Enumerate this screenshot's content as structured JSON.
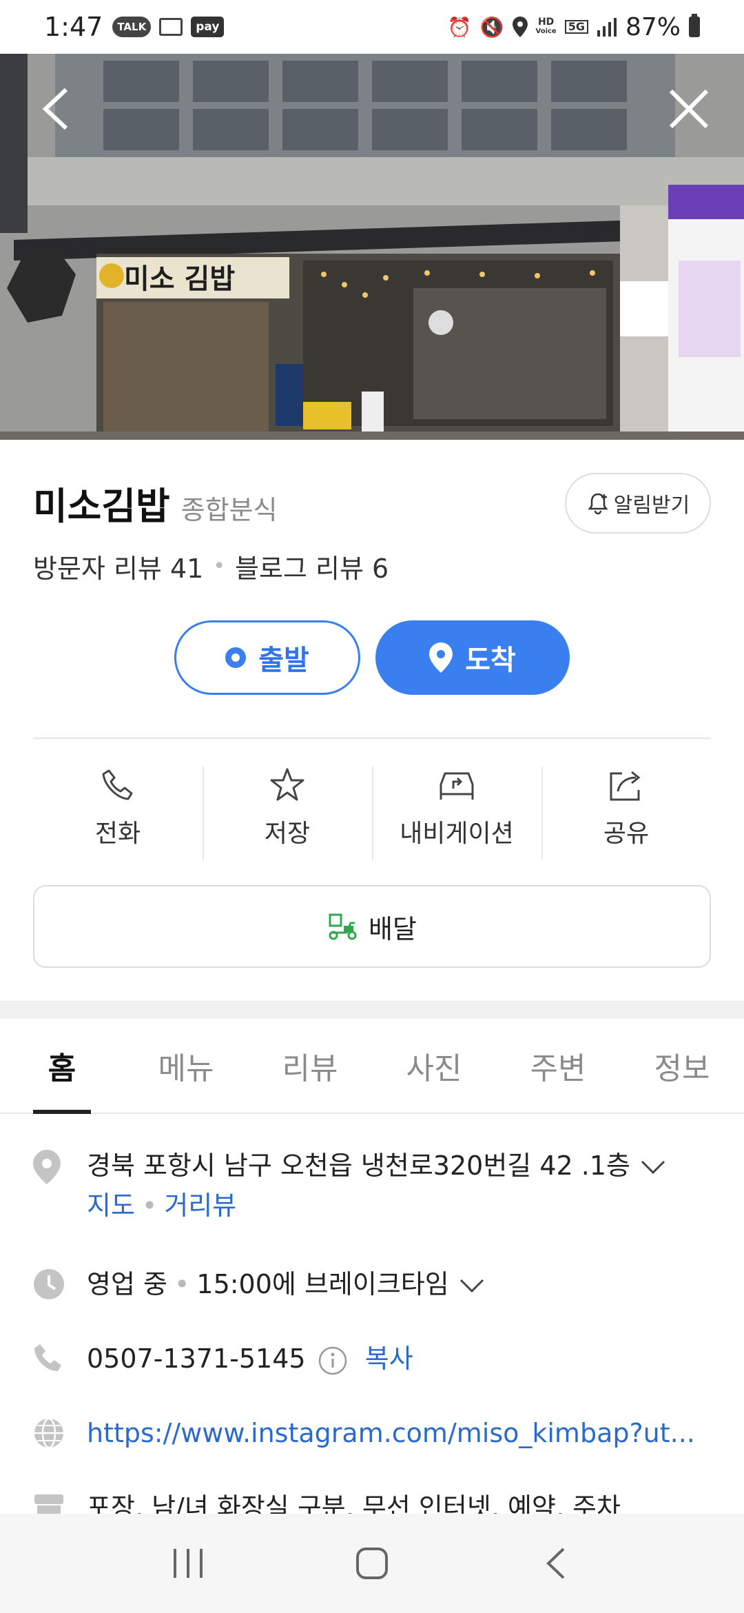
{
  "status_bar": {
    "time": "1:47",
    "talk_label": "TALK",
    "pay_label": "pay",
    "hd_label": "HD",
    "voice_label": "Voice",
    "network_label": "5G",
    "battery": "87%"
  },
  "place": {
    "name": "미소김밥",
    "category": "종합분식",
    "alert_label": "알림받기",
    "visitor_reviews_label": "방문자 리뷰",
    "visitor_reviews_count": "41",
    "blog_reviews_label": "블로그 리뷰",
    "blog_reviews_count": "6"
  },
  "route": {
    "depart_label": "출발",
    "arrive_label": "도착"
  },
  "actions": [
    {
      "label": "전화",
      "icon": "phone-icon"
    },
    {
      "label": "저장",
      "icon": "star-icon"
    },
    {
      "label": "내비게이션",
      "icon": "car-navigation-icon"
    },
    {
      "label": "공유",
      "icon": "share-icon"
    }
  ],
  "delivery": {
    "label": "배달",
    "icon": "delivery-scooter-icon"
  },
  "tabs": [
    {
      "label": "홈",
      "active": true
    },
    {
      "label": "메뉴",
      "active": false
    },
    {
      "label": "리뷰",
      "active": false
    },
    {
      "label": "사진",
      "active": false
    },
    {
      "label": "주변",
      "active": false
    },
    {
      "label": "정보",
      "active": false
    }
  ],
  "info": {
    "address": "경북 포항시 남구 오천읍 냉천로320번길 42 .1층",
    "map_link": "지도",
    "street_view_link": "거리뷰",
    "status": "영업 중",
    "break_time": "15:00에 브레이크타임",
    "phone": "0507-1371-5145",
    "copy_label": "복사",
    "website": "https://www.instagram.com/miso_kimbap?ut...",
    "amenities": "포장, 남/녀 화장실 구분, 무선 인터넷, 예약, 주차"
  },
  "hero": {
    "sign_text": "미소 김밥"
  },
  "colors": {
    "accent": "#3a7ff0",
    "link": "#2a6acc",
    "delivery_green": "#2fa84f"
  }
}
